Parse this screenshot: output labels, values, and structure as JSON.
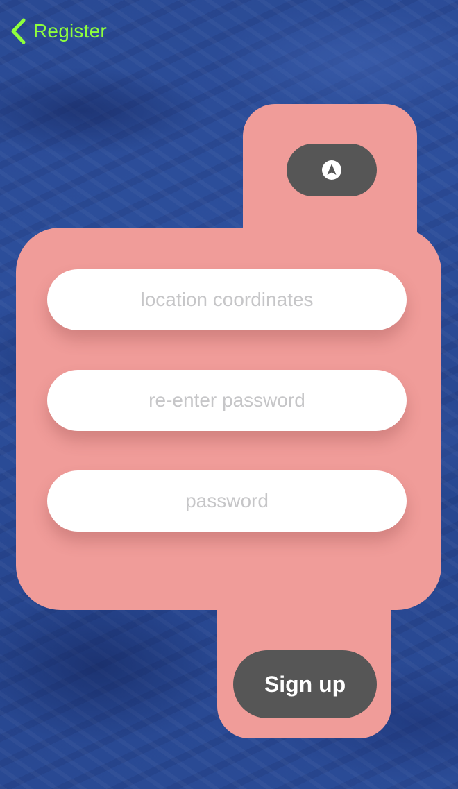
{
  "nav": {
    "back_label": "Register",
    "back_icon": "chevron-left-icon",
    "accent_color": "#8eff3c"
  },
  "location_button": {
    "icon": "navigation-arrow-icon"
  },
  "form": {
    "location_placeholder": "location coordinates",
    "reenter_password_placeholder": "re-enter password",
    "password_placeholder": "password"
  },
  "actions": {
    "signup_label": "Sign up"
  },
  "colors": {
    "panel": "#f09c99",
    "button": "#565656",
    "field": "#ffffff",
    "background": "#2c4c95"
  }
}
